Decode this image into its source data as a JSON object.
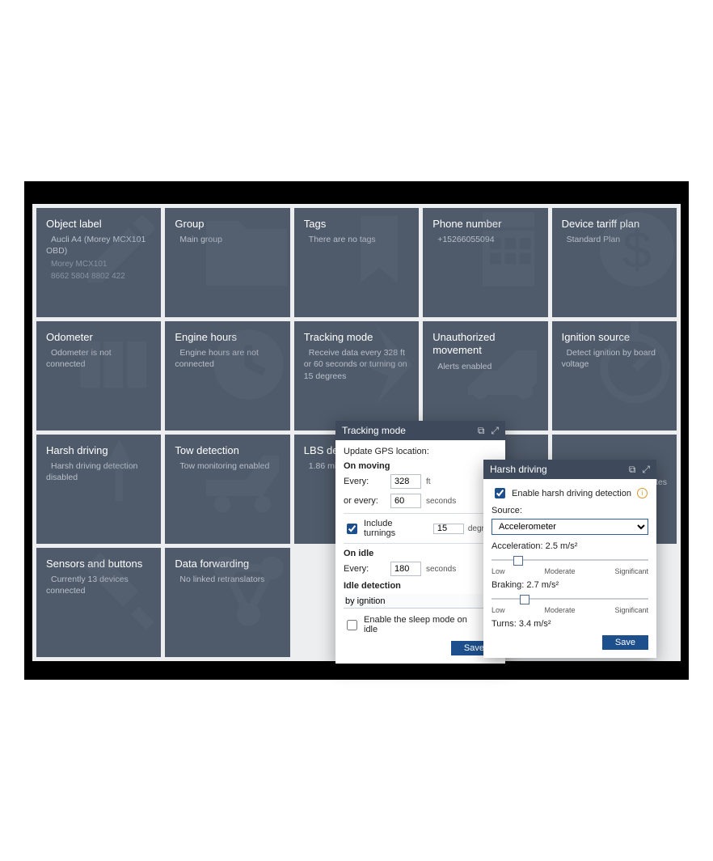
{
  "cards": {
    "object_label": {
      "title": "Object label",
      "line1": "Aucli A4 (Morey MCX101 OBD)",
      "line2": "Morey MCX101",
      "line3": "8662 5804 8802 422"
    },
    "group": {
      "title": "Group",
      "line1": "Main group"
    },
    "tags": {
      "title": "Tags",
      "line1": "There are no tags"
    },
    "phone": {
      "title": "Phone number",
      "line1": "+15266055094"
    },
    "tariff": {
      "title": "Device tariff plan",
      "line1": "Standard Plan"
    },
    "odometer": {
      "title": "Odometer",
      "line1": "Odometer is not connected"
    },
    "engine": {
      "title": "Engine hours",
      "line1": "Engine hours are not connected"
    },
    "tracking": {
      "title": "Tracking mode",
      "line1": "Receive data every 328 ft or 60 seconds or turning on 15 degrees"
    },
    "unauth": {
      "title": "Unauthorized movement",
      "line1": "Alerts enabled"
    },
    "ignition": {
      "title": "Ignition source",
      "line1": "Detect ignition by board voltage"
    },
    "harsh": {
      "title": "Harsh driving",
      "line1": "Harsh driving detection disabled"
    },
    "tow": {
      "title": "Tow detection",
      "line1": "Tow monitoring enabled"
    },
    "lbs": {
      "title": "LBS detect",
      "line1": "1.86 mi"
    },
    "minutes_hint": "nutes",
    "sensors": {
      "title": "Sensors and buttons",
      "line1": "Currently 13 devices connected"
    },
    "forward": {
      "title": "Data forwarding",
      "line1": "No linked retranslators"
    }
  },
  "popup_tracking": {
    "title": "Tracking mode",
    "update_label": "Update GPS location:",
    "on_moving": "On moving",
    "every": "Every:",
    "or_every": "or every:",
    "val_dist": "328",
    "unit_dist": "ft",
    "val_time": "60",
    "unit_time": "seconds",
    "include_turn": "Include turnings",
    "val_turn": "15",
    "unit_turn": "degrees",
    "on_idle": "On idle",
    "val_idle": "180",
    "unit_idle": "seconds",
    "idle_det": "Idle detection",
    "idle_mode": "by ignition",
    "sleep": "Enable the sleep mode on idle",
    "save": "Save"
  },
  "popup_harsh": {
    "title": "Harsh driving",
    "enable": "Enable harsh driving detection",
    "source": "Source:",
    "source_val": "Accelerometer",
    "accel": "Acceleration: 2.5 m/s²",
    "brake": "Braking: 2.7 m/s²",
    "turns": "Turns: 3.4 m/s²",
    "low": "Low",
    "mod": "Moderate",
    "sig": "Significant",
    "save": "Save"
  }
}
